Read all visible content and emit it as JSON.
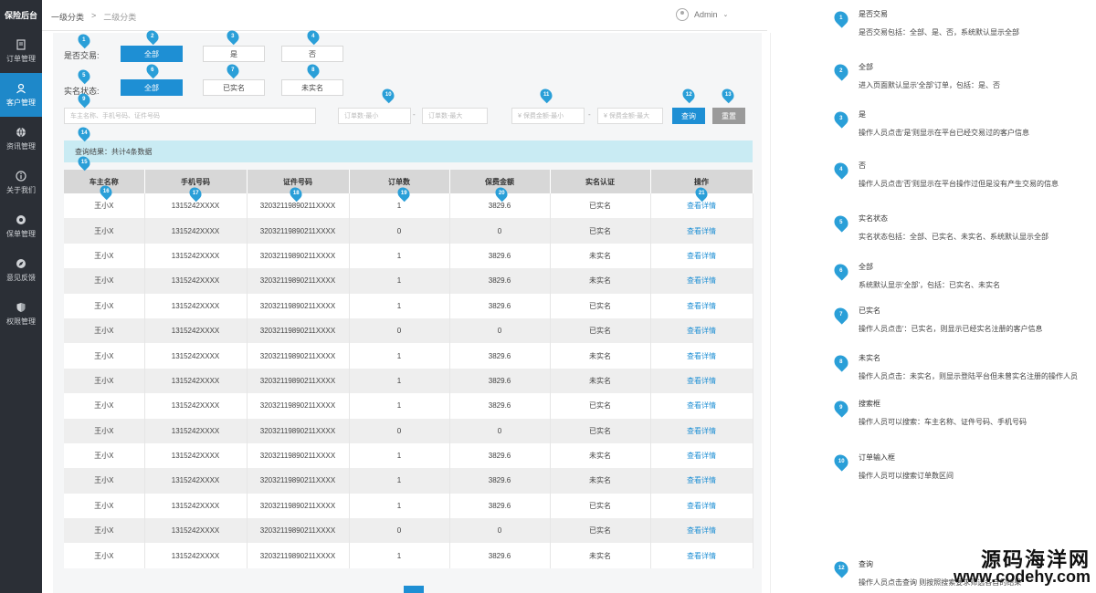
{
  "sidebar": {
    "brand": "保险后台",
    "items": [
      {
        "label": "订单管理",
        "icon": "document-icon"
      },
      {
        "label": "客户管理",
        "icon": "user-icon"
      },
      {
        "label": "资讯管理",
        "icon": "globe-icon"
      },
      {
        "label": "关于我们",
        "icon": "info-icon"
      },
      {
        "label": "保单管理",
        "icon": "policy-icon"
      },
      {
        "label": "意见反馈",
        "icon": "compass-icon"
      },
      {
        "label": "权限管理",
        "icon": "shield-icon"
      }
    ]
  },
  "header": {
    "crumb_first": "一级分类",
    "crumb_sep": ">",
    "crumb_second": "二级分类",
    "user": "Admin"
  },
  "filters": {
    "trade_label": "是否交易:",
    "trade_options": [
      "全部",
      "是",
      "否"
    ],
    "realname_label": "实名状态:",
    "realname_options": [
      "全部",
      "已实名",
      "未实名"
    ],
    "search_placeholder": "车主名称、手机号码、证件号码",
    "order_min_placeholder": "订单数-最小",
    "order_max_placeholder": "订单数-最大",
    "amount_min_placeholder": "¥ 保费金额-最小",
    "amount_max_placeholder": "¥ 保费金额-最大",
    "dash": "-",
    "query_label": "查询",
    "reset_label": "重置"
  },
  "result_text": "查询结果：共计4条数据",
  "table": {
    "headers": [
      "车主名称",
      "手机号码",
      "证件号码",
      "订单数",
      "保费金额",
      "实名认证",
      "操作"
    ],
    "rows": [
      [
        "王小X",
        "1315242XXXX",
        "32032119890211XXXX",
        "1",
        "3829.6",
        "已实名",
        "查看详情"
      ],
      [
        "王小X",
        "1315242XXXX",
        "32032119890211XXXX",
        "0",
        "0",
        "已实名",
        "查看详情"
      ],
      [
        "王小X",
        "1315242XXXX",
        "32032119890211XXXX",
        "1",
        "3829.6",
        "未实名",
        "查看详情"
      ],
      [
        "王小X",
        "1315242XXXX",
        "32032119890211XXXX",
        "1",
        "3829.6",
        "未实名",
        "查看详情"
      ],
      [
        "王小X",
        "1315242XXXX",
        "32032119890211XXXX",
        "1",
        "3829.6",
        "已实名",
        "查看详情"
      ],
      [
        "王小X",
        "1315242XXXX",
        "32032119890211XXXX",
        "0",
        "0",
        "已实名",
        "查看详情"
      ],
      [
        "王小X",
        "1315242XXXX",
        "32032119890211XXXX",
        "1",
        "3829.6",
        "未实名",
        "查看详情"
      ],
      [
        "王小X",
        "1315242XXXX",
        "32032119890211XXXX",
        "1",
        "3829.6",
        "未实名",
        "查看详情"
      ],
      [
        "王小X",
        "1315242XXXX",
        "32032119890211XXXX",
        "1",
        "3829.6",
        "已实名",
        "查看详情"
      ],
      [
        "王小X",
        "1315242XXXX",
        "32032119890211XXXX",
        "0",
        "0",
        "已实名",
        "查看详情"
      ],
      [
        "王小X",
        "1315242XXXX",
        "32032119890211XXXX",
        "1",
        "3829.6",
        "未实名",
        "查看详情"
      ],
      [
        "王小X",
        "1315242XXXX",
        "32032119890211XXXX",
        "1",
        "3829.6",
        "未实名",
        "查看详情"
      ],
      [
        "王小X",
        "1315242XXXX",
        "32032119890211XXXX",
        "1",
        "3829.6",
        "已实名",
        "查看详情"
      ],
      [
        "王小X",
        "1315242XXXX",
        "32032119890211XXXX",
        "0",
        "0",
        "已实名",
        "查看详情"
      ],
      [
        "王小X",
        "1315242XXXX",
        "32032119890211XXXX",
        "1",
        "3829.6",
        "未实名",
        "查看详情"
      ]
    ]
  },
  "markers": [
    "1",
    "2",
    "3",
    "4",
    "5",
    "6",
    "7",
    "8",
    "9",
    "10",
    "11",
    "12",
    "13",
    "14",
    "15",
    "16",
    "17",
    "18",
    "19",
    "20",
    "21"
  ],
  "notes": [
    {
      "num": "1",
      "title": "是否交易",
      "desc": "是否交易包括：全部、是、否，系统默认显示全部"
    },
    {
      "num": "2",
      "title": "全部",
      "desc": "进入页面默认显示'全部'订单，包括：是、否"
    },
    {
      "num": "3",
      "title": "是",
      "desc": "操作人员点击'是'则显示在平台已经交易过的客户信息"
    },
    {
      "num": "4",
      "title": "否",
      "desc": "操作人员点击'否'则显示在平台操作过但是没有产生交易的信息"
    },
    {
      "num": "5",
      "title": "实名状态",
      "desc": "实名状态包括：全部、已实名、未实名、系统默认显示全部"
    },
    {
      "num": "6",
      "title": "全部",
      "desc": "系统默认显示'全部'，包括：已实名、未实名"
    },
    {
      "num": "7",
      "title": "已实名",
      "desc": "操作人员点击'：已实名，则显示已经实名注册的客户信息"
    },
    {
      "num": "8",
      "title": "未实名",
      "desc": "操作人员点击：未实名，则显示登陆平台但未曾实名注册的操作人员"
    },
    {
      "num": "9",
      "title": "搜索框",
      "desc": "操作人员可以搜索：车主名称、证件号码、手机号码"
    },
    {
      "num": "10",
      "title": "订单输入框",
      "desc": "操作人员可以搜索订单数区间"
    },
    {
      "num": "12",
      "title": "查询",
      "desc": "操作人员点击查询 则按照搜索要求筛选各自的结果"
    }
  ],
  "watermark": {
    "line1": "源码海洋网",
    "line2": "www.codehy.com"
  },
  "colors": {
    "accent": "#1e8fd4",
    "sidebar": "#2b2f36",
    "result_bar": "#c9ebf3",
    "pin": "#2a9fd8"
  }
}
